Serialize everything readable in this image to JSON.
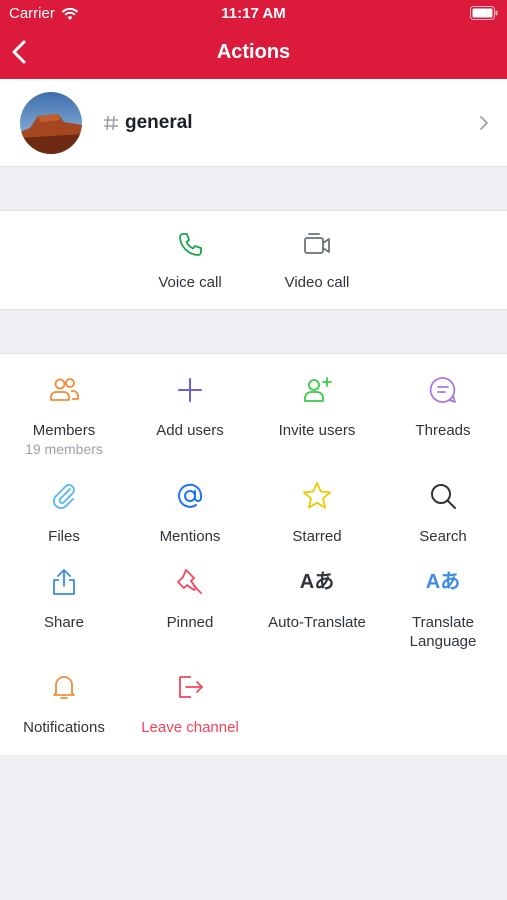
{
  "status_bar": {
    "carrier": "Carrier",
    "time": "11:17 AM"
  },
  "header": {
    "title": "Actions",
    "back_icon": "chevron-left-icon"
  },
  "channel": {
    "hash": "#",
    "name": "general"
  },
  "calls": [
    {
      "label": "Voice call",
      "icon": "phone-icon",
      "color": "#2de0a5"
    },
    {
      "label": "Video call",
      "icon": "video-camera-icon",
      "color": "#6c727a"
    }
  ],
  "actions": [
    {
      "label": "Members",
      "sublabel": "19 members",
      "icon": "members-icon",
      "color": "#f38c39"
    },
    {
      "label": "Add users",
      "icon": "plus-icon",
      "color": "#6c5fd8"
    },
    {
      "label": "Invite users",
      "icon": "add-user-icon",
      "color": "#2de0a5"
    },
    {
      "label": "Threads",
      "icon": "threads-icon",
      "color": "#a97ae6"
    },
    {
      "label": "Files",
      "icon": "paperclip-icon",
      "color": "#55b4f0"
    },
    {
      "label": "Mentions",
      "icon": "at-sign-icon",
      "color": "#1d74f5"
    },
    {
      "label": "Starred",
      "icon": "star-icon",
      "color": "#f3d12b"
    },
    {
      "label": "Search",
      "icon": "search-icon",
      "color": "#2f343d"
    },
    {
      "label": "Share",
      "icon": "share-icon",
      "color": "#3c8ce6"
    },
    {
      "label": "Pinned",
      "icon": "pin-icon",
      "color": "#f5455c"
    },
    {
      "label": "Auto-Translate",
      "icon": "translate-icon",
      "glyph": "Aあ",
      "color": "#2f343d"
    },
    {
      "label": "Translate",
      "label2": "Language",
      "icon": "translate-icon",
      "glyph": "Aあ",
      "color": "#3c8ce6"
    },
    {
      "label": "Notifications",
      "icon": "bell-icon",
      "color": "#f38c39"
    },
    {
      "label": "Leave channel",
      "icon": "leave-icon",
      "color": "#f5455c"
    }
  ]
}
